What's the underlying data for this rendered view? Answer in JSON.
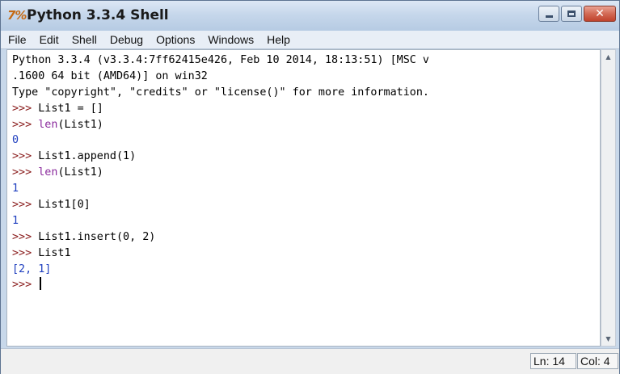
{
  "window": {
    "title": "Python 3.3.4 Shell",
    "icon_text": "7%",
    "icon_name": "python-idle-icon",
    "controls": [
      "minimize-icon",
      "maximize-icon",
      "close-icon"
    ],
    "close_glyph": "✕"
  },
  "menubar": {
    "items": [
      "File",
      "Edit",
      "Shell",
      "Debug",
      "Options",
      "Windows",
      "Help"
    ]
  },
  "shell": {
    "lines": [
      [
        {
          "t": "Python 3.3.4 (v3.3.4:7ff62415e426, Feb 10 2014, 18:13:51) [MSC v",
          "k": "out"
        }
      ],
      [
        {
          "t": ".1600 64 bit (AMD64)] on win32",
          "k": "out"
        }
      ],
      [
        {
          "t": "Type \"copyright\", \"credits\" or \"license()\" for more information.",
          "k": "out"
        }
      ],
      [
        {
          "t": ">>> ",
          "k": "prompt"
        },
        {
          "t": "List1 = []",
          "k": "in"
        }
      ],
      [
        {
          "t": ">>> ",
          "k": "prompt"
        },
        {
          "t": "len",
          "k": "builtin"
        },
        {
          "t": "(List1)",
          "k": "in"
        }
      ],
      [
        {
          "t": "0",
          "k": "result"
        }
      ],
      [
        {
          "t": ">>> ",
          "k": "prompt"
        },
        {
          "t": "List1.append(1)",
          "k": "in"
        }
      ],
      [
        {
          "t": ">>> ",
          "k": "prompt"
        },
        {
          "t": "len",
          "k": "builtin"
        },
        {
          "t": "(List1)",
          "k": "in"
        }
      ],
      [
        {
          "t": "1",
          "k": "result"
        }
      ],
      [
        {
          "t": ">>> ",
          "k": "prompt"
        },
        {
          "t": "List1[0]",
          "k": "in"
        }
      ],
      [
        {
          "t": "1",
          "k": "result"
        }
      ],
      [
        {
          "t": ">>> ",
          "k": "prompt"
        },
        {
          "t": "List1.insert(0, 2)",
          "k": "in"
        }
      ],
      [
        {
          "t": ">>> ",
          "k": "prompt"
        },
        {
          "t": "List1",
          "k": "in"
        }
      ],
      [
        {
          "t": "[2, 1]",
          "k": "result"
        }
      ],
      [
        {
          "t": ">>> ",
          "k": "prompt"
        }
      ]
    ]
  },
  "status": {
    "line": "Ln: 14",
    "col": "Col: 4"
  },
  "colors": {
    "prompt": "#8a1d1d",
    "builtin": "#8a2a9c",
    "result": "#1f3fbf",
    "text": "#000000"
  }
}
